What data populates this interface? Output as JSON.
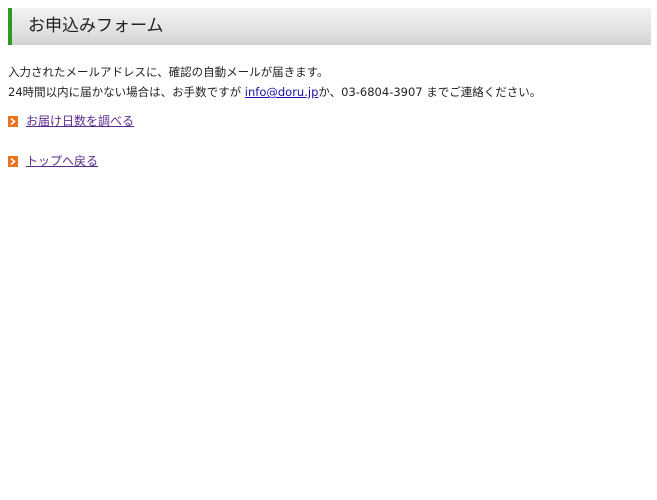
{
  "header": {
    "title": "お申込みフォーム"
  },
  "message": {
    "line1": "入力されたメールアドレスに、確認の自動メールが届きます。",
    "line2_prefix": "24時間以内に届かない場合は、お手数ですが ",
    "email": "info@doru.jp",
    "line2_suffix": "か、03-6804-3907 までご連絡ください。"
  },
  "links": {
    "delivery_days": "お届け日数を調べる",
    "back_to_top": "トップへ戻る"
  },
  "colors": {
    "header_accent": "#2e9a26",
    "bullet_icon": "#e8731e",
    "visited_link": "#5a2a8f",
    "email_link": "#1a0dab"
  },
  "icons": {
    "bullet": "orange-arrow-icon"
  }
}
